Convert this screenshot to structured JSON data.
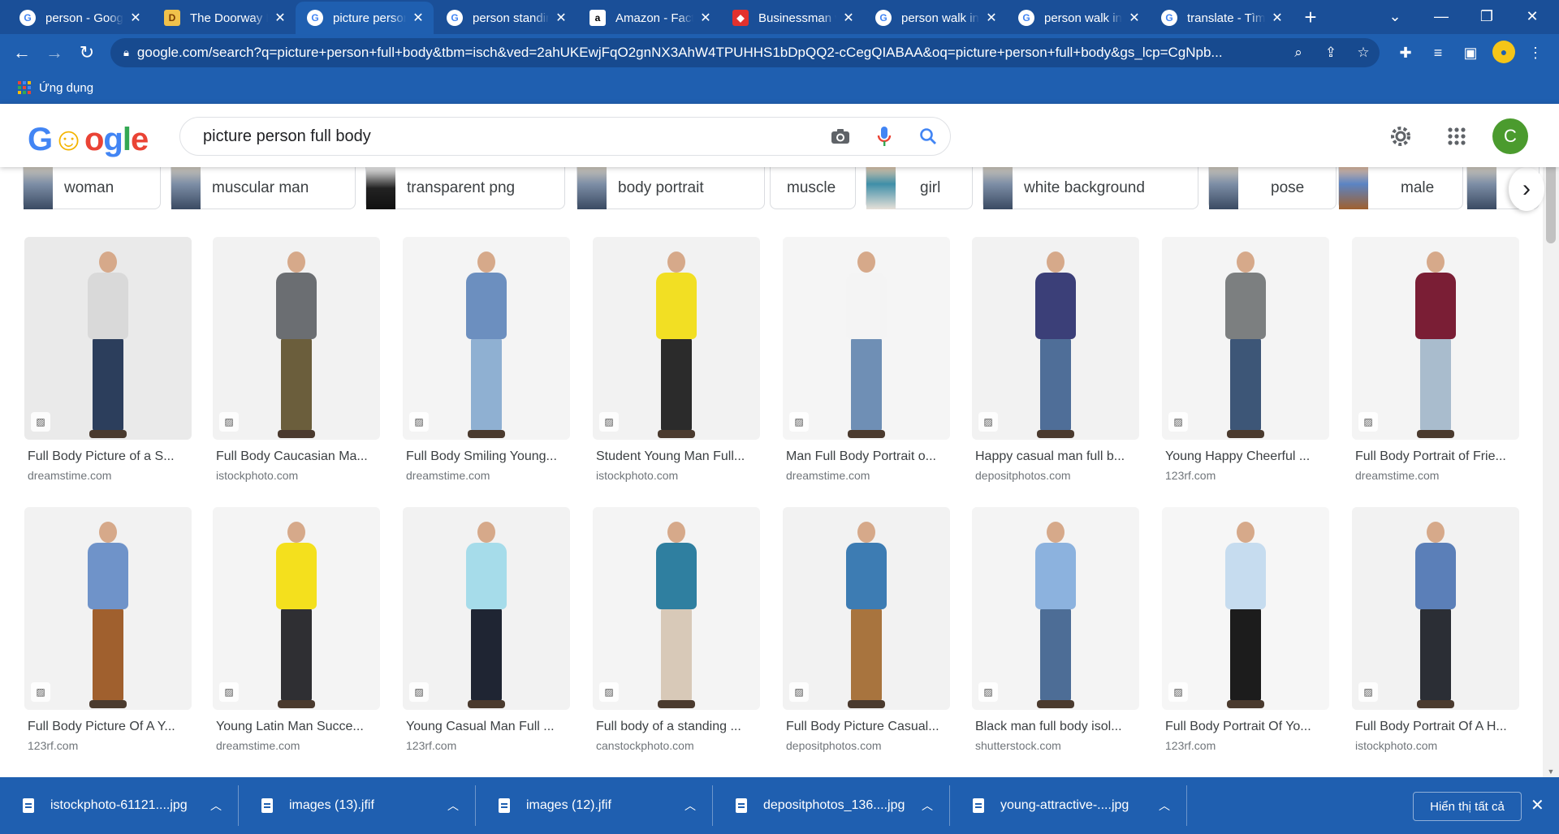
{
  "tabs": [
    {
      "label": "person - Goog",
      "favicon": "google"
    },
    {
      "label": "The Doorway I",
      "favicon": "doorway"
    },
    {
      "label": "picture person",
      "favicon": "google",
      "active": true
    },
    {
      "label": "person standin",
      "favicon": "google"
    },
    {
      "label": "Amazon - Fact",
      "favicon": "amazon"
    },
    {
      "label": "Businessman w",
      "favicon": "red"
    },
    {
      "label": "person walk in",
      "favicon": "google"
    },
    {
      "label": "person walk in",
      "favicon": "google"
    },
    {
      "label": "translate - Tìm",
      "favicon": "google"
    }
  ],
  "omnibox": {
    "url": "google.com/search?q=picture+person+full+body&tbm=isch&ved=2ahUKEwjFqO2gnNX3AhW4TPUHHS1bDpQQ2-cCegQIABAA&oq=picture+person+full+body&gs_lcp=CgNpb..."
  },
  "bookmarks": {
    "apps_label": "Ứng dụng"
  },
  "search": {
    "query": "picture person full body",
    "logo": "Google"
  },
  "profile": {
    "initial": "C"
  },
  "chips": [
    {
      "label": "woman"
    },
    {
      "label": "muscular man"
    },
    {
      "label": "transparent png"
    },
    {
      "label": "body portrait"
    },
    {
      "label": "muscle"
    },
    {
      "label": "girl"
    },
    {
      "label": "white background"
    },
    {
      "label": "pose"
    },
    {
      "label": "male"
    }
  ],
  "results": [
    {
      "title": "Full Body Picture of a S...",
      "source": "dreamstime.com",
      "shirt": "#d9d9d9",
      "pants": "#2c3e5c",
      "bg": "#eaeaea"
    },
    {
      "title": "Full Body Caucasian Ma...",
      "source": "istockphoto.com",
      "shirt": "#6b6e72",
      "pants": "#6b5e3c",
      "bg": "#f2f2f2"
    },
    {
      "title": "Full Body Smiling Young...",
      "source": "dreamstime.com",
      "shirt": "#6c8fbf",
      "pants": "#8fb0d2",
      "bg": "#f4f4f4"
    },
    {
      "title": "Student Young Man Full...",
      "source": "istockphoto.com",
      "shirt": "#f2df23",
      "pants": "#2b2b2b",
      "bg": "#f2f2f2"
    },
    {
      "title": "Man Full Body Portrait o...",
      "source": "dreamstime.com",
      "shirt": "#f4f4f4",
      "pants": "#6f8fb5",
      "bg": "#f5f5f5"
    },
    {
      "title": "Happy casual man full b...",
      "source": "depositphotos.com",
      "shirt": "#3b3f78",
      "pants": "#4f6e98",
      "bg": "#f2f2f2"
    },
    {
      "title": "Young Happy Cheerful ...",
      "source": "123rf.com",
      "shirt": "#7c7f80",
      "pants": "#3d5677",
      "bg": "#f4f4f4"
    },
    {
      "title": "Full Body Portrait of Frie...",
      "source": "dreamstime.com",
      "shirt": "#7a1e35",
      "pants": "#a9bccd",
      "bg": "#f4f4f4"
    },
    {
      "title": "Full Body Picture Of A Y...",
      "source": "123rf.com",
      "shirt": "#6f93c9",
      "pants": "#a0602e",
      "bg": "#f2f2f2"
    },
    {
      "title": "Young Latin Man Succe...",
      "source": "dreamstime.com",
      "shirt": "#f4e01d",
      "pants": "#2f2f33",
      "bg": "#f4f4f4"
    },
    {
      "title": "Young Casual Man Full ...",
      "source": "123rf.com",
      "shirt": "#a6dcea",
      "pants": "#1f2533",
      "bg": "#f2f2f2"
    },
    {
      "title": "Full body of a standing ...",
      "source": "canstockphoto.com",
      "shirt": "#2f7fa0",
      "pants": "#d8c9b8",
      "bg": "#f4f4f4"
    },
    {
      "title": "Full Body Picture Casual...",
      "source": "depositphotos.com",
      "shirt": "#3d7cb3",
      "pants": "#a8743e",
      "bg": "#f2f2f2"
    },
    {
      "title": "Black man full body isol...",
      "source": "shutterstock.com",
      "shirt": "#8cb2de",
      "pants": "#4d6d96",
      "bg": "#f4f4f4"
    },
    {
      "title": "Full Body Portrait Of Yo...",
      "source": "123rf.com",
      "shirt": "#c6dcef",
      "pants": "#1c1c1c",
      "bg": "#f6f6f6"
    },
    {
      "title": "Full Body Portrait Of A H...",
      "source": "istockphoto.com",
      "shirt": "#5b7fb8",
      "pants": "#2b2e35",
      "bg": "#f2f2f2"
    }
  ],
  "downloads": [
    {
      "name": "istockphoto-61121....jpg"
    },
    {
      "name": "images (13).jfif"
    },
    {
      "name": "images (12).jfif"
    },
    {
      "name": "depositphotos_136....jpg"
    },
    {
      "name": "young-attractive-....jpg"
    }
  ],
  "downloads_bar": {
    "show_all": "Hiển thị tất cả"
  }
}
